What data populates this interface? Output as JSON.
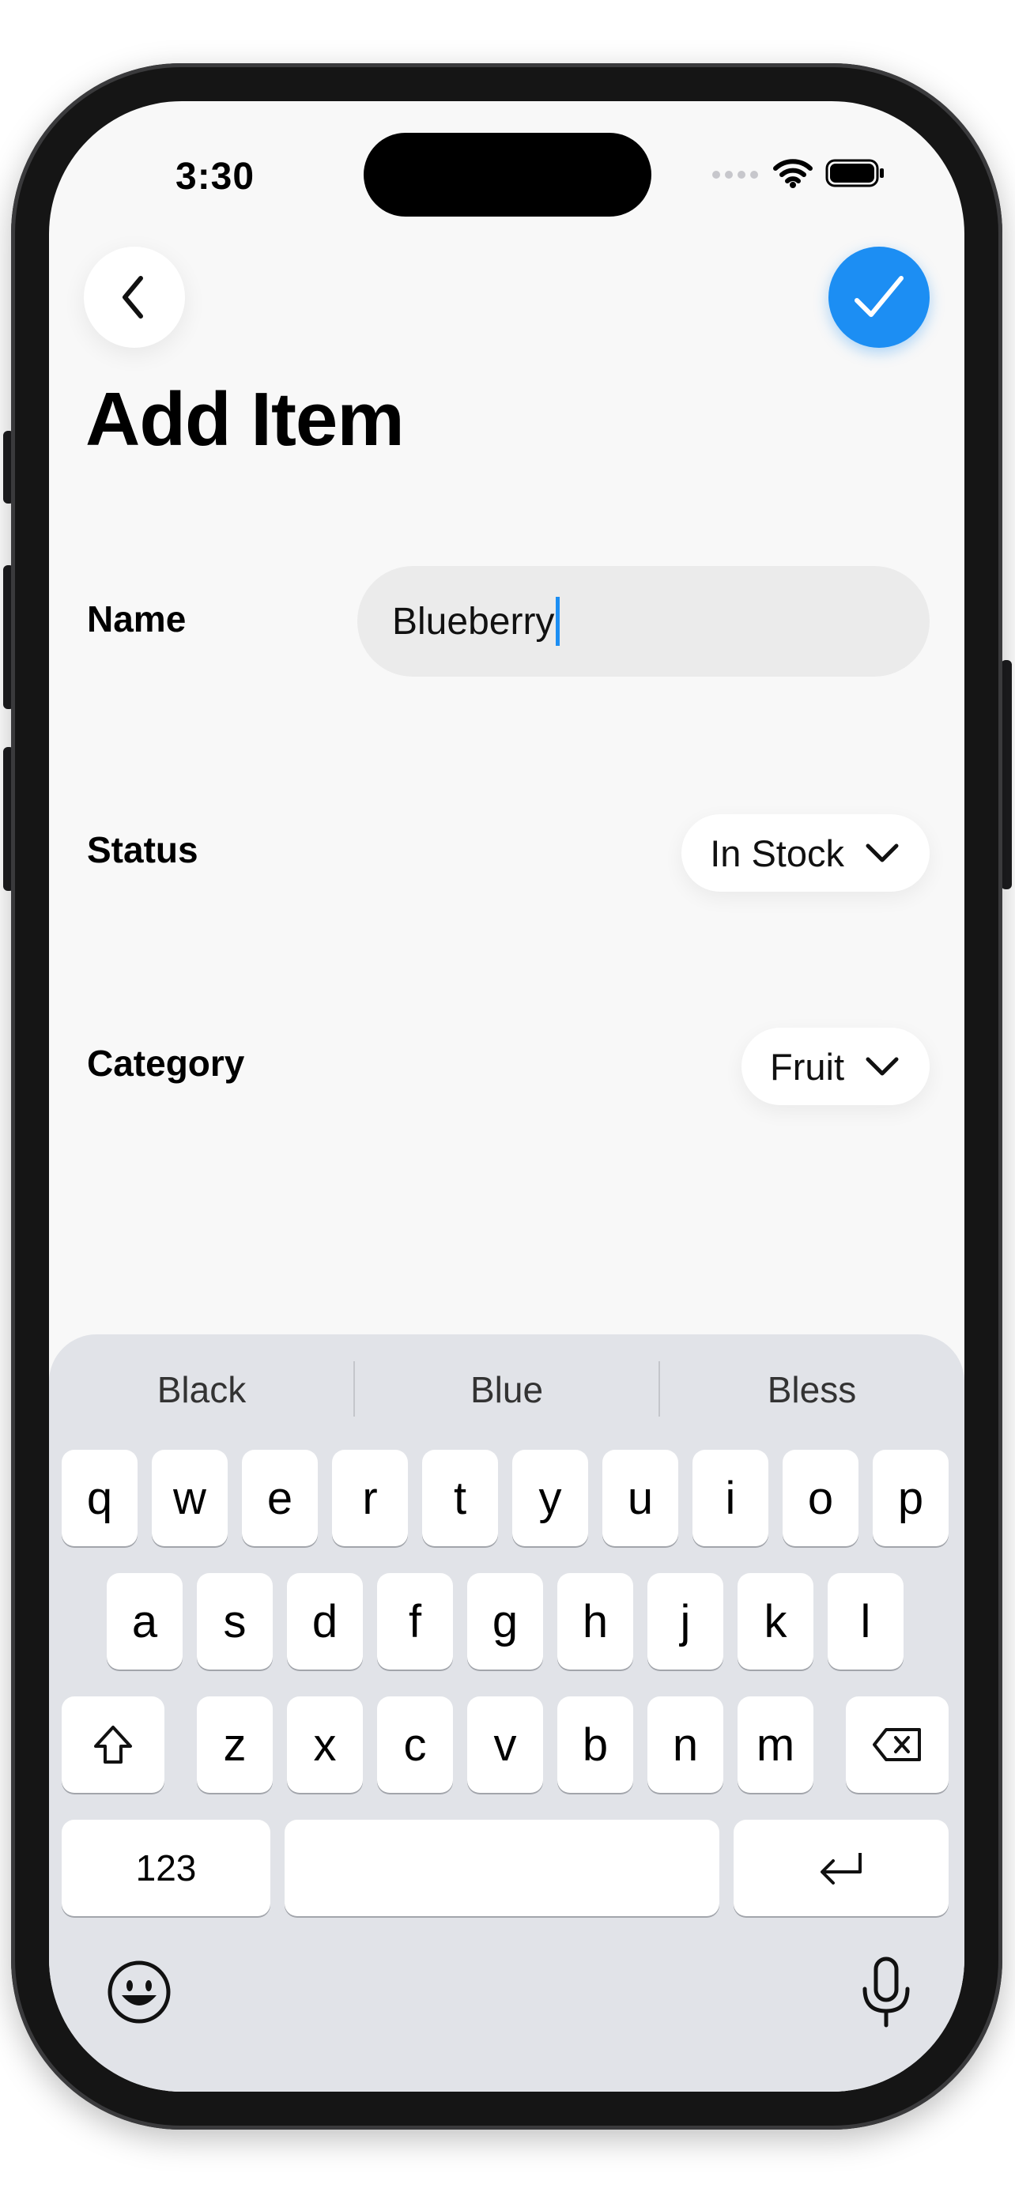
{
  "status_bar": {
    "time": "3:30"
  },
  "header": {
    "back_icon": "chevron-left-icon",
    "done_icon": "checkmark-icon",
    "title": "Add Item"
  },
  "form": {
    "name_label": "Name",
    "name_value": "Blueberry",
    "status_label": "Status",
    "status_value": "In Stock",
    "category_label": "Category",
    "category_value": "Fruit"
  },
  "keyboard": {
    "suggestions": [
      "Black",
      "Blue",
      "Bless"
    ],
    "row1": [
      "q",
      "w",
      "e",
      "r",
      "t",
      "y",
      "u",
      "i",
      "o",
      "p"
    ],
    "row2": [
      "a",
      "s",
      "d",
      "f",
      "g",
      "h",
      "j",
      "k",
      "l"
    ],
    "row3": [
      "z",
      "x",
      "c",
      "v",
      "b",
      "n",
      "m"
    ],
    "numbers_label": "123",
    "emoji_icon": "emoji-icon",
    "mic_icon": "microphone-icon"
  },
  "colors": {
    "accent": "#1c8ef3",
    "keyboard_bg": "#e1e3e8",
    "screen_bg": "#f8f8f8"
  }
}
